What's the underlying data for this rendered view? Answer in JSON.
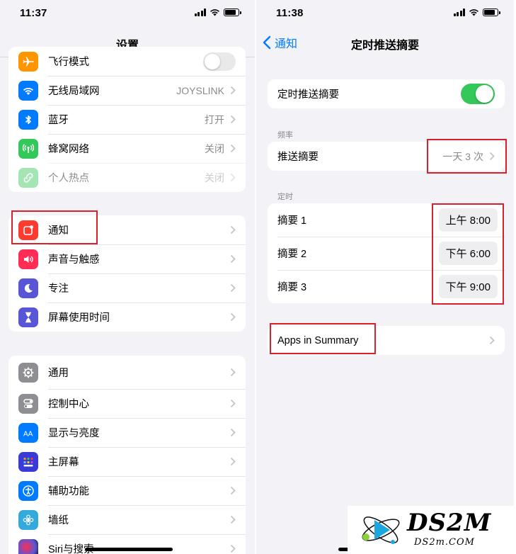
{
  "left": {
    "status_time": "11:37",
    "nav_title": "设置",
    "group1": [
      {
        "label": "飞行模式",
        "value": "",
        "icon": "airplane-icon",
        "color": "#ff9500"
      },
      {
        "label": "无线局域网",
        "value": "JOYSLINK",
        "icon": "wifi-icon",
        "color": "#007aff"
      },
      {
        "label": "蓝牙",
        "value": "打开",
        "icon": "bluetooth-icon",
        "color": "#007aff"
      },
      {
        "label": "蜂窝网络",
        "value": "关闭",
        "icon": "cellular-icon",
        "color": "#34c759"
      },
      {
        "label": "个人热点",
        "value": "关闭",
        "icon": "hotspot-icon",
        "color": "#34c759"
      }
    ],
    "group2": [
      {
        "label": "通知",
        "icon": "notification-icon",
        "color": "#ff3b30"
      },
      {
        "label": "声音与触感",
        "icon": "sound-icon",
        "color": "#ff2d55"
      },
      {
        "label": "专注",
        "icon": "focus-moon-icon",
        "color": "#5856d6"
      },
      {
        "label": "屏幕使用时间",
        "icon": "hourglass-icon",
        "color": "#5856d6"
      }
    ],
    "group3": [
      {
        "label": "通用",
        "icon": "gear-icon",
        "color": "#8e8e93"
      },
      {
        "label": "控制中心",
        "icon": "control-center-icon",
        "color": "#8e8e93"
      },
      {
        "label": "显示与亮度",
        "icon": "display-icon",
        "color": "#007aff"
      },
      {
        "label": "主屏幕",
        "icon": "home-screen-icon",
        "color": "#3a3ad6"
      },
      {
        "label": "辅助功能",
        "icon": "accessibility-icon",
        "color": "#007aff"
      },
      {
        "label": "墙纸",
        "icon": "wallpaper-flower-icon",
        "color": "#34aadc"
      },
      {
        "label": "Siri与搜索",
        "icon": "siri-icon",
        "color": "#222222"
      }
    ]
  },
  "right": {
    "status_time": "11:38",
    "back_label": "通知",
    "nav_title": "定时推送摘要",
    "toggle_label": "定时推送摘要",
    "toggle_on": true,
    "frequency_header": "频率",
    "frequency_label": "推送摘要",
    "frequency_value": "一天 3 次",
    "schedule_header": "定时",
    "summaries": [
      {
        "label": "摘要 1",
        "time": "上午 8:00"
      },
      {
        "label": "摘要 2",
        "time": "下午 6:00"
      },
      {
        "label": "摘要 3",
        "time": "下午 9:00"
      }
    ],
    "apps_label": "Apps in Summary"
  },
  "watermark": {
    "main": "DS2M",
    "sub": "DS2m.COM"
  },
  "colors": {
    "accent": "#007aff",
    "toggle_on": "#34c759",
    "annotation": "#d9202e"
  }
}
